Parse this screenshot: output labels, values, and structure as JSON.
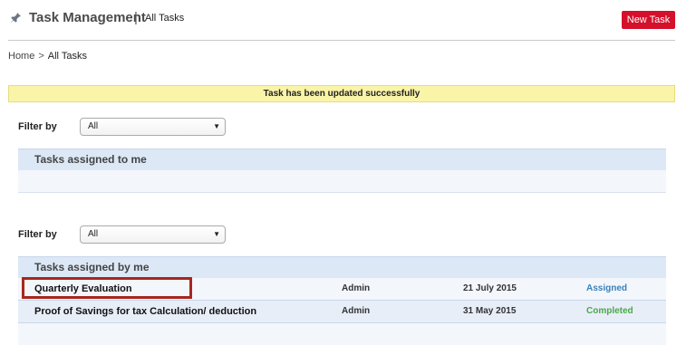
{
  "header": {
    "app_title": "Task Management",
    "separator": "|",
    "view_label": "All Tasks",
    "new_task_label": "New Task",
    "accent_color": "#d4102b"
  },
  "breadcrumb": {
    "home": "Home",
    "separator": ">",
    "current": "All Tasks"
  },
  "alert": {
    "message": "Task has been updated successfully"
  },
  "filter_top": {
    "label": "Filter by",
    "selected": "All"
  },
  "assigned_to_me": {
    "title": "Tasks assigned to me"
  },
  "filter_bottom": {
    "label": "Filter by",
    "selected": "All"
  },
  "assigned_by_me": {
    "title": "Tasks assigned by me",
    "rows": [
      {
        "name": "Quarterly Evaluation",
        "by": "Admin",
        "date": "21 July 2015",
        "status": "Assigned",
        "status_color": "#3a82b8"
      },
      {
        "name": "Proof of Savings for tax Calculation/ deduction",
        "by": "Admin",
        "date": "31 May 2015",
        "status": "Completed",
        "status_color": "#4aa84a"
      }
    ]
  }
}
